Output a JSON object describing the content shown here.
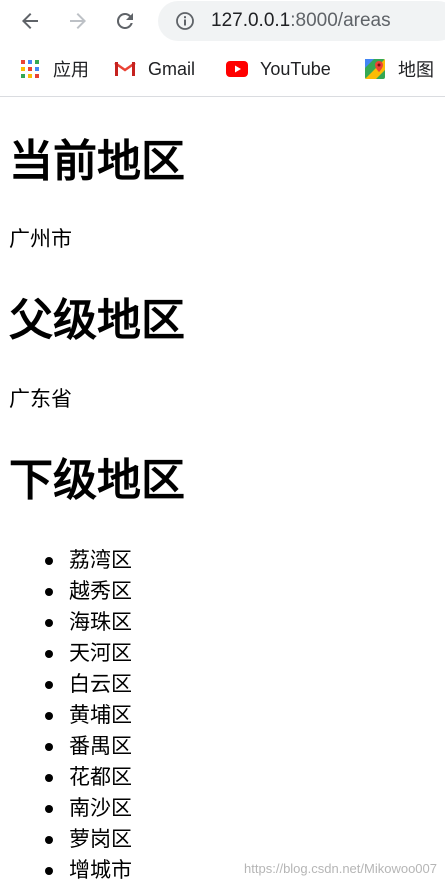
{
  "browser": {
    "url_host": "127.0.0.1",
    "url_rest": ":8000/areas",
    "bookmarks": [
      {
        "label": "应用",
        "icon": "apps-grid-icon"
      },
      {
        "label": "Gmail",
        "icon": "gmail-icon"
      },
      {
        "label": "YouTube",
        "icon": "youtube-icon"
      },
      {
        "label": "地图",
        "icon": "maps-icon"
      }
    ]
  },
  "page": {
    "current_heading": "当前地区",
    "current_value": "广州市",
    "parent_heading": "父级地区",
    "parent_value": "广东省",
    "sub_heading": "下级地区",
    "sub_areas": [
      "荔湾区",
      "越秀区",
      "海珠区",
      "天河区",
      "白云区",
      "黄埔区",
      "番禺区",
      "花都区",
      "南沙区",
      "萝岗区",
      "增城市"
    ]
  },
  "watermark": "https://blog.csdn.net/Mikowoo007",
  "colors": {
    "omnibox_bg": "#f1f3f4",
    "youtube_red": "#ff0000"
  }
}
